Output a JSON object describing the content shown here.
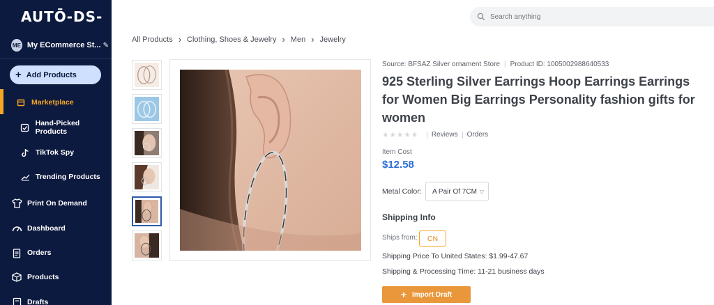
{
  "brand": {
    "logo_text": "AUTŌ-DS-"
  },
  "store": {
    "avatar_initials": "ME",
    "name": "My ECommerce St..."
  },
  "sidebar": {
    "add_products_label": "Add Products",
    "items": [
      {
        "label": "Marketplace",
        "icon": "shop-icon",
        "active": true
      },
      {
        "label": "Hand-Picked Products",
        "icon": "hand-picked-icon"
      },
      {
        "label": "TikTok Spy",
        "icon": "tiktok-icon"
      },
      {
        "label": "Trending Products",
        "icon": "trending-icon"
      },
      {
        "label": "Print On Demand",
        "icon": "tshirt-icon"
      },
      {
        "label": "Dashboard",
        "icon": "gauge-icon"
      },
      {
        "label": "Orders",
        "icon": "clipboard-icon"
      },
      {
        "label": "Products",
        "icon": "box-icon"
      },
      {
        "label": "Drafts",
        "icon": "drafts-icon"
      }
    ],
    "active_color": "#f5a623",
    "background": "#0d1a3f"
  },
  "search": {
    "placeholder": "Search anything"
  },
  "breadcrumb": [
    "All Products",
    "Clothing, Shoes & Jewelry",
    "Men",
    "Jewelry"
  ],
  "product": {
    "source": "Source: BFSAZ Silver ornament Store",
    "product_id": "Product ID: 1005002988640533",
    "title": "925 Sterling Silver Earrings Hoop Earrings Earrings for Women Big Earrings Personality fashion gifts for women",
    "reviews_label": "Reviews",
    "orders_label": "Orders",
    "cost_label": "Item Cost",
    "price": "$12.58",
    "metal_color_label": "Metal Color:",
    "metal_color_value": "A Pair Of 7CM",
    "shipping_title": "Shipping Info",
    "ships_from_label": "Ships from:",
    "ships_from_value": "CN",
    "shipping_price": "Shipping Price To United States:  $1.99-47.67",
    "shipping_time": "Shipping & Processing Time:  11-21 business days",
    "import_label": "Import Draft",
    "selected_thumbnail": 5,
    "accent_price_color": "#2a6fd6",
    "accent_button_color": "#e9973a"
  }
}
